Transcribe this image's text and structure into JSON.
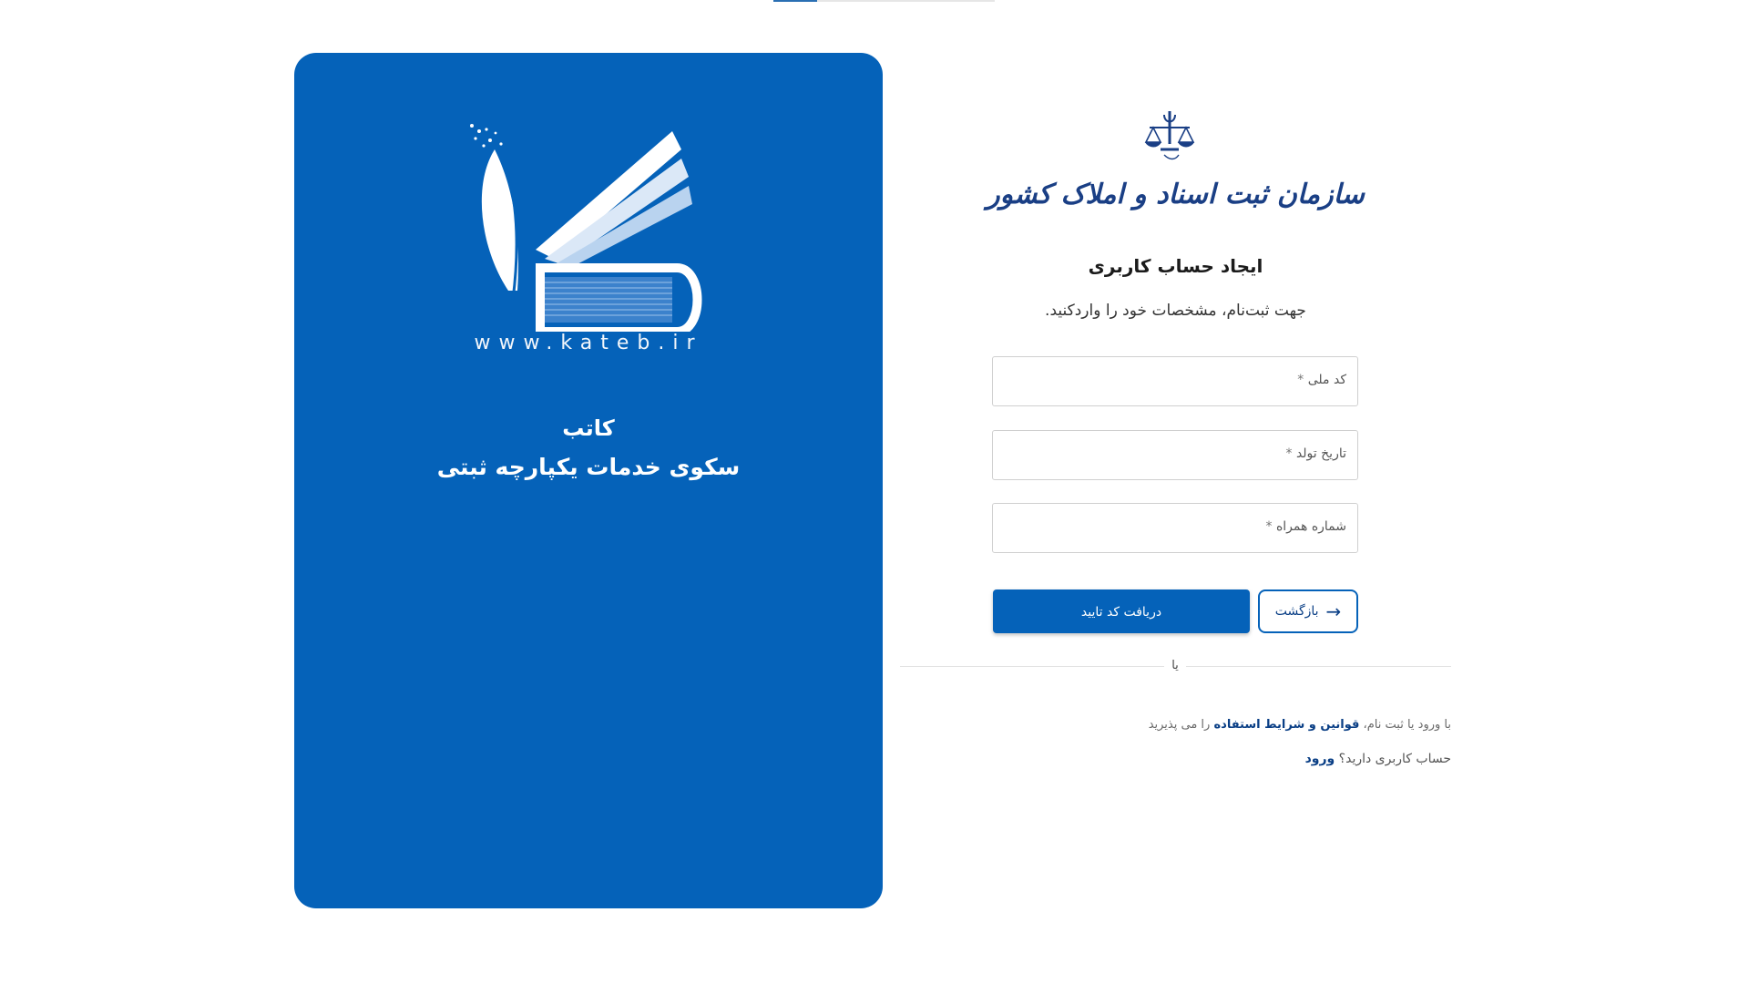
{
  "brand": {
    "url": "www.kateb.ir",
    "name": "کاتب",
    "tagline": "سکوی خدمات یکپارچه ثبتی",
    "logo_icon": "kateb-logo-icon"
  },
  "org": {
    "name": "سازمان ثبت اسناد و املاک کشور",
    "emblem_icon": "justice-emblem-icon"
  },
  "form": {
    "title": "ایجاد حساب کاربری",
    "subtitle": "جهت ثبت‌نام، مشخصات خود را واردکنید.",
    "fields": [
      {
        "label": "کد ملی",
        "required_mark": "*",
        "value": ""
      },
      {
        "label": "تاریخ تولد",
        "required_mark": "*",
        "value": ""
      },
      {
        "label": "شماره همراه",
        "required_mark": "*",
        "value": ""
      }
    ],
    "submit_label": "دریافت کد تایید",
    "back_label": "بازگشت",
    "back_icon": "arrow-right-icon",
    "divider_label": "یا",
    "terms": {
      "prefix": "با ورود یا ثبت نام،",
      "link": "قوانین و شرایط استفاده",
      "suffix": "را می پذیرید"
    },
    "login": {
      "prompt": "حساب کاربری دارید؟",
      "link": "ورود"
    }
  },
  "colors": {
    "primary": "#0562b9",
    "link": "#0a3f86",
    "org_text": "#1a3f85"
  }
}
